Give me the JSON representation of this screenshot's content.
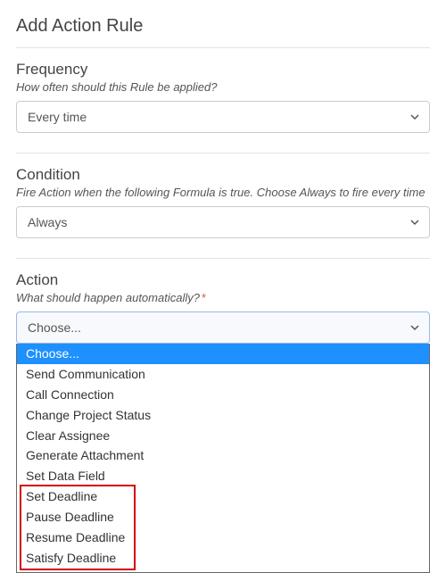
{
  "page_title": "Add Action Rule",
  "sections": {
    "frequency": {
      "heading": "Frequency",
      "desc": "How often should this Rule be applied?",
      "value": "Every time"
    },
    "condition": {
      "heading": "Condition",
      "desc": "Fire Action when the following Formula is true. Choose Always to fire every time",
      "value": "Always"
    },
    "action": {
      "heading": "Action",
      "desc": "What should happen automatically?",
      "required_mark": "*",
      "value": "Choose...",
      "options": [
        "Choose...",
        "Send Communication",
        "Call Connection",
        "Change Project Status",
        "Clear Assignee",
        "Generate Attachment",
        "Set Data Field",
        "Set Deadline",
        "Pause Deadline",
        "Resume Deadline",
        "Satisfy Deadline"
      ],
      "selected_index": 0,
      "highlight_start": 7,
      "highlight_end": 10
    }
  }
}
